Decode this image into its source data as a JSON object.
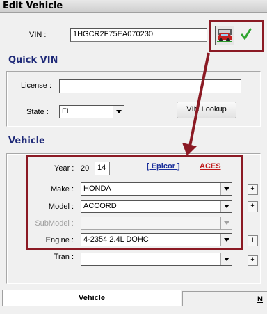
{
  "window": {
    "title": "Edit Vehicle"
  },
  "vin": {
    "label": "VIN :",
    "value": "1HGCR2F75EA070230"
  },
  "quick_vin": {
    "heading": "Quick VIN",
    "license_label": "License :",
    "license_value": "",
    "state_label": "State :",
    "state_value": "FL",
    "lookup_button": "VIN Lookup"
  },
  "vehicle": {
    "heading": "Vehicle",
    "year_label": "Year :",
    "year_prefix": "20",
    "year_value": "14",
    "epicor_link": "[ Epicor ]",
    "aces_link": "ACES",
    "make_label": "Make :",
    "make_value": "HONDA",
    "model_label": "Model :",
    "model_value": "ACCORD",
    "submodel_label": "SubModel :",
    "submodel_value": "",
    "engine_label": "Engine :",
    "engine_value": "4-2354 2.4L DOHC",
    "tran_label": "Tran :",
    "tran_value": "",
    "plus_label": "+"
  },
  "tabs": [
    {
      "label": "Vehicle"
    },
    {
      "label": "N"
    }
  ],
  "colors": {
    "highlight_border": "#8b1a24",
    "heading": "#1f2a78",
    "link_blue": "#1a2f9b",
    "link_red": "#c01a1a",
    "check_green": "#2fa52f"
  },
  "icons": [
    "car-decode-icon",
    "checkmark-icon",
    "arrow-annotation"
  ]
}
